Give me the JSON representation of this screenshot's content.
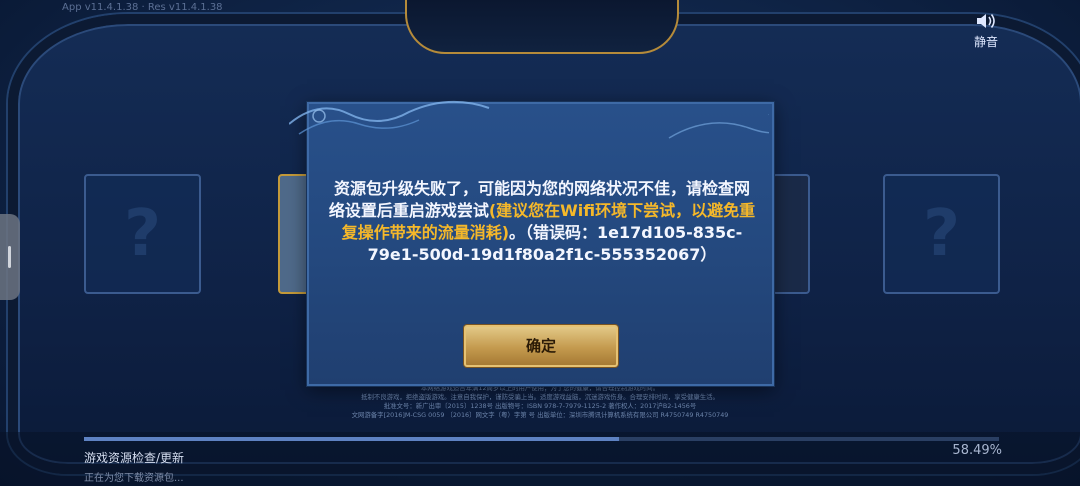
{
  "header": {
    "version_text": "App v11.4.1.38 · Res v11.4.1.38",
    "mute_label": "静音"
  },
  "background": {
    "card_question_mark": "?"
  },
  "legal_lines": [
    "本网络游戏适合年满12周岁以上的用户使用；为了您的健康，请合理控制游戏时间。",
    "抵制不良游戏，拒绝盗版游戏。注意自我保护，谨防受骗上当。适度游戏益脑，沉迷游戏伤身。合理安排时间，享受健康生活。",
    "批准文号：新广出审〔2015〕1238号  出版物号：ISBN 978-7-7979-1125-2  著作权人：2017沪B2-1456号",
    "文网游备字[2016]M-CSG 0059  〔2016〕网文字（粤）字第    号  出版单位：深圳市腾讯计算机系统有限公司 R4750749 R4750749"
  ],
  "progress": {
    "title": "游戏资源检查/更新",
    "subtitle": "正在为您下载资源包...",
    "percent_text": "58.49%",
    "fraction": 0.5849
  },
  "dialog": {
    "message_part1": "资源包升级失败了，可能因为您的网络状况不佳，请检查网络设置后重启游戏尝试",
    "message_highlight": "(建议您在Wifi环境下尝试，以避免重复操作带来的流量消耗)",
    "message_part2": "。（错误码：1e17d105-835c-79e1-500d-19d1f80a2f1c-555352067）",
    "ok_label": "确定"
  },
  "colors": {
    "highlight": "#f5b82a",
    "button_gold": "#c49a4e",
    "dialog_bg": "#24497f"
  }
}
